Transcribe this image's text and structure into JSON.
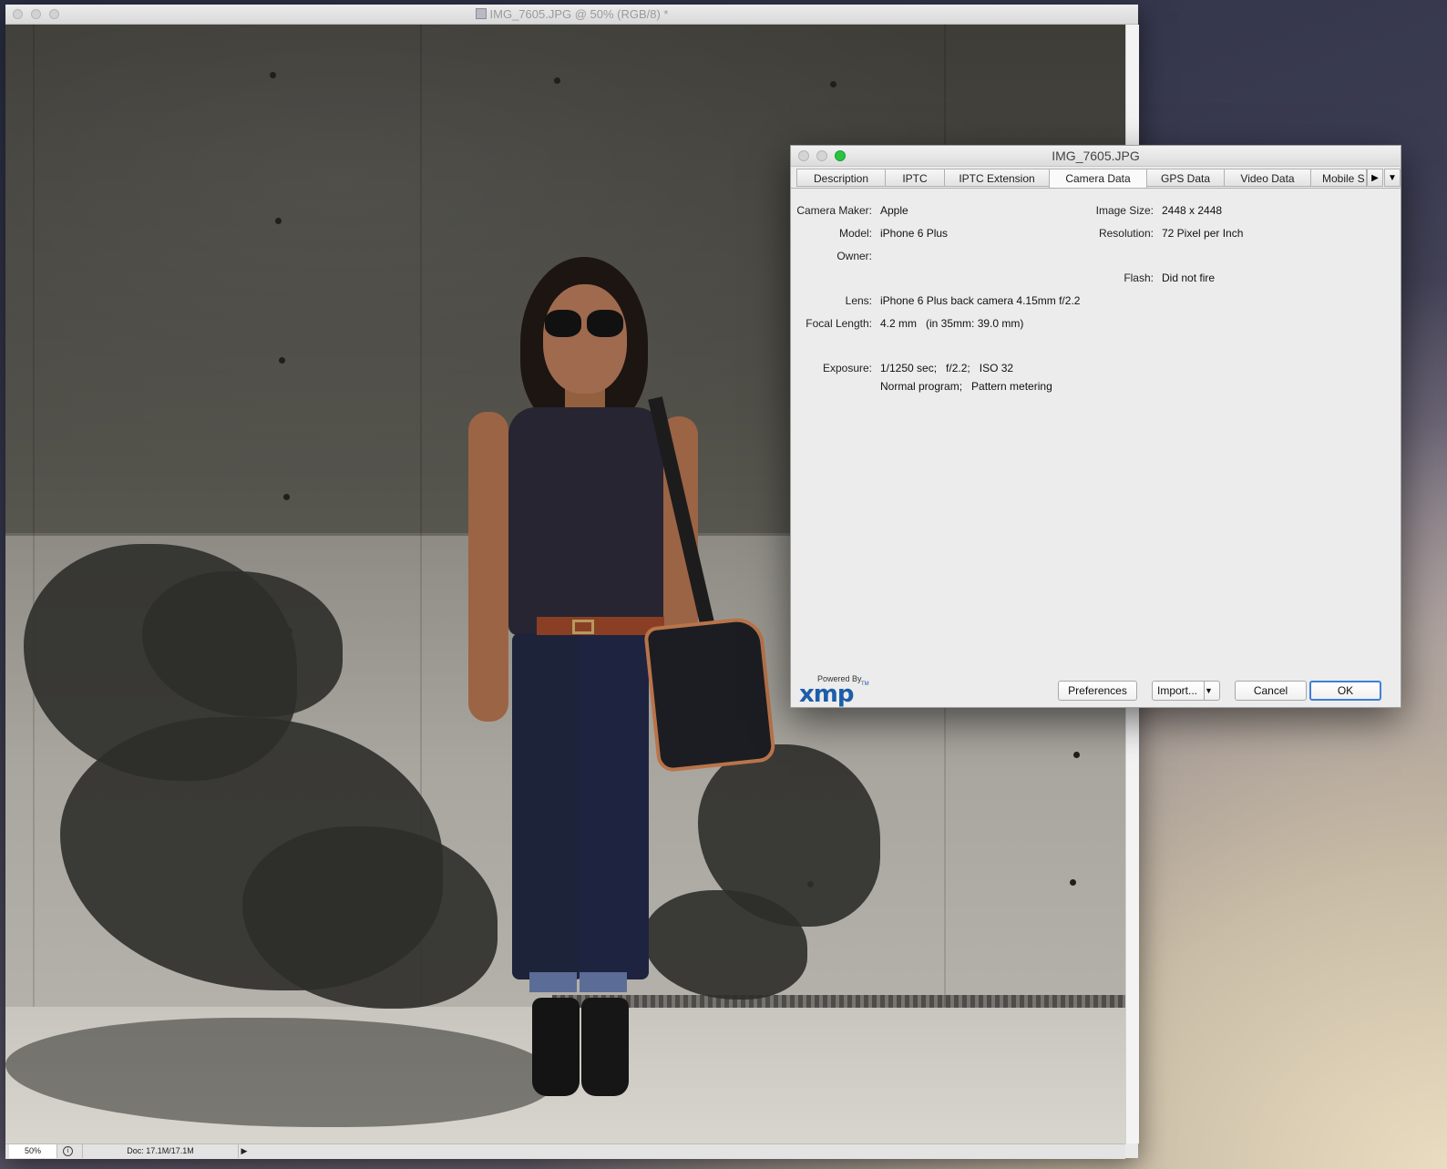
{
  "document_window": {
    "title": "IMG_7605.JPG @ 50% (RGB/8) *",
    "status_zoom": "50%",
    "status_doc_size": "Doc: 17.1M/17.1M"
  },
  "dialog": {
    "title": "IMG_7605.JPG",
    "tabs": [
      {
        "label": "Description"
      },
      {
        "label": "IPTC"
      },
      {
        "label": "IPTC Extension"
      },
      {
        "label": "Camera Data"
      },
      {
        "label": "GPS Data"
      },
      {
        "label": "Video Data"
      },
      {
        "label": "Mobile S"
      }
    ],
    "active_tab": "Camera Data",
    "fields": {
      "camera_maker_label": "Camera Maker:",
      "camera_maker": "Apple",
      "model_label": "Model:",
      "model": "iPhone 6 Plus",
      "owner_label": "Owner:",
      "owner": "",
      "lens_label": "Lens:",
      "lens": "iPhone 6 Plus back camera 4.15mm f/2.2",
      "focal_length_label": "Focal Length:",
      "focal_length": "4.2 mm   (in 35mm: 39.0 mm)",
      "exposure_label": "Exposure:",
      "exposure_line1": "1/1250 sec;   f/2.2;   ISO 32",
      "exposure_line2": "Normal program;   Pattern metering",
      "image_size_label": "Image Size:",
      "image_size": "2448 x 2448",
      "resolution_label": "Resolution:",
      "resolution": "72 Pixel per Inch",
      "flash_label": "Flash:",
      "flash": "Did not fire"
    },
    "branding": {
      "powered_by": "Powered By",
      "logo": "xmp",
      "trademark": "TM"
    },
    "buttons": {
      "preferences": "Preferences",
      "import": "Import...",
      "cancel": "Cancel",
      "ok": "OK"
    }
  },
  "colors": {
    "accent_blue": "#3f7fd6",
    "xmp_blue": "#1d5ea8",
    "traffic_green": "#2bc441"
  },
  "icons": [
    "photoshop-doc-icon",
    "tab-scroll-right-icon",
    "tab-menu-chevron-icon",
    "import-dropdown-icon",
    "status-arrow-icon"
  ]
}
